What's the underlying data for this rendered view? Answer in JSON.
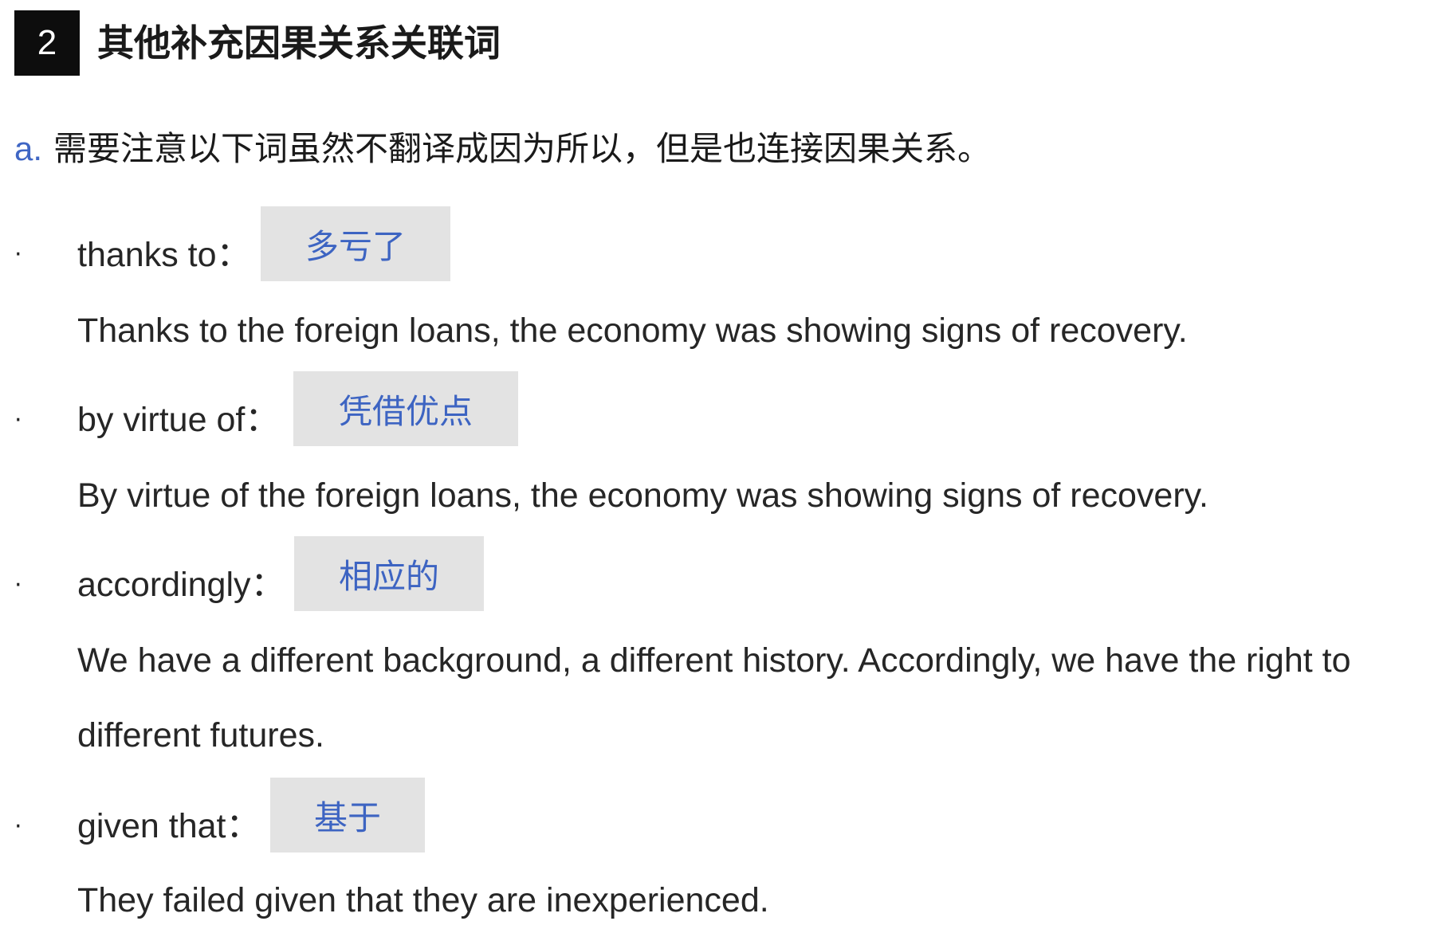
{
  "section": {
    "number": "2",
    "title": "其他补充因果关系关联词"
  },
  "intro": {
    "letter": "a.",
    "text": "需要注意以下词虽然不翻译成因为所以，但是也连接因果关系。"
  },
  "items": [
    {
      "bullet": "·",
      "term": "thanks to：",
      "meaning": "多亏了",
      "example": "Thanks to the foreign loans, the economy was showing signs of recovery."
    },
    {
      "bullet": "·",
      "term": "by virtue of：",
      "meaning": "凭借优点",
      "example": "By virtue of the foreign loans, the economy was showing signs of recovery."
    },
    {
      "bullet": "·",
      "term": "accordingly：",
      "meaning": "相应的",
      "example": "We have a different background, a different history. Accordingly, we have the right to",
      "example_cont": "different futures."
    },
    {
      "bullet": "·",
      "term": "given that：",
      "meaning": "基于",
      "example": "They failed given that they are inexperienced."
    }
  ]
}
